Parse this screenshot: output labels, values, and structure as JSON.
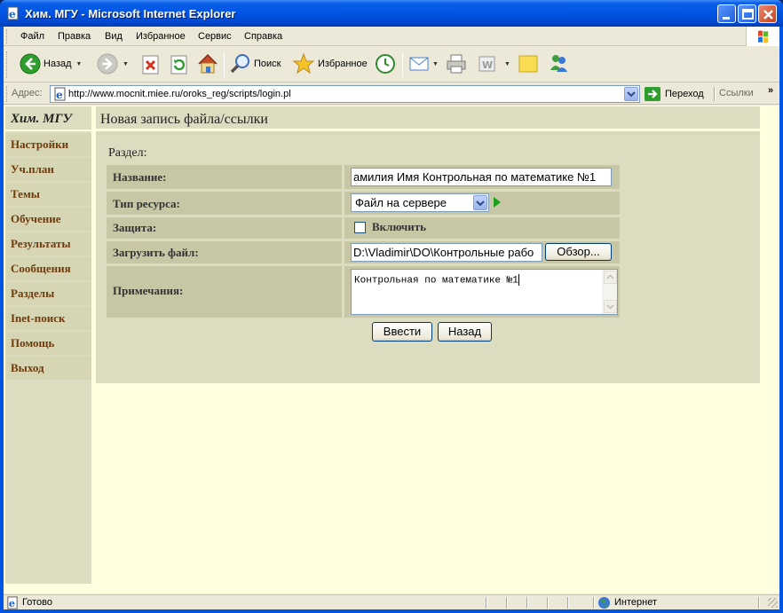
{
  "window": {
    "title": "Хим. МГУ - Microsoft Internet Explorer"
  },
  "menu": {
    "items": [
      {
        "label": "Файл"
      },
      {
        "label": "Правка"
      },
      {
        "label": "Вид"
      },
      {
        "label": "Избранное"
      },
      {
        "label": "Сервис"
      },
      {
        "label": "Справка"
      }
    ]
  },
  "toolbar": {
    "back_label": "Назад",
    "search_label": "Поиск",
    "favorites_label": "Избранное"
  },
  "address": {
    "label": "Адрес:",
    "url": "http://www.mocnit.miee.ru/oroks_reg/scripts/login.pl",
    "go_label": "Переход",
    "links_label": "Ссылки",
    "links_more": "»"
  },
  "sidebar": {
    "logo": "Хим. МГУ",
    "items": [
      {
        "label": "Настройки"
      },
      {
        "label": "Уч.план"
      },
      {
        "label": "Темы"
      },
      {
        "label": "Обучение"
      },
      {
        "label": "Результаты"
      },
      {
        "label": "Сообщения"
      },
      {
        "label": "Разделы"
      },
      {
        "label": "Inet-поиск"
      },
      {
        "label": "Помощь"
      },
      {
        "label": "Выход"
      }
    ]
  },
  "page": {
    "heading": "Новая запись файла/ссылки",
    "section_label": "Раздел:",
    "form": {
      "name_label": "Название:",
      "name_value": "амилия Имя Контрольная по математике №1",
      "type_label": "Тип ресурса:",
      "type_value": "Файл на сервере",
      "protect_label": "Защита:",
      "protect_checkbox_label": "Включить",
      "upload_label": "Загрузить файл:",
      "upload_value": "D:\\Vladimir\\DO\\Контрольные рабо",
      "browse_label": "Обзор...",
      "notes_label": "Примечания:",
      "notes_value": "Контрольная по математике №1",
      "submit_label": "Ввести",
      "back_label": "Назад"
    }
  },
  "status": {
    "text": "Готово",
    "zone": "Интернет"
  },
  "colors": {
    "sidebar_link": "#6e3b0c",
    "page_bg": "#ffffe0",
    "panel_bg": "#dcdcc0",
    "label_bg": "#c7c7a5"
  }
}
